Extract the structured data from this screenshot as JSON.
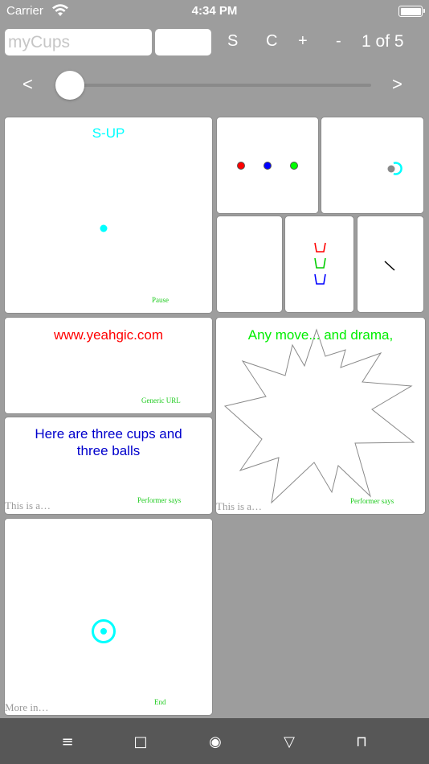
{
  "status": {
    "carrier": "Carrier",
    "time": "4:34 PM"
  },
  "toolbar": {
    "name_placeholder": "myCups",
    "s_label": "S",
    "c_label": "C",
    "plus_label": "+",
    "minus_label": "-",
    "page_count": "1 of 5"
  },
  "slider": {
    "prev_label": "<",
    "next_label": ">",
    "value_fraction": 0.0
  },
  "tiles": {
    "sup": {
      "title": "S-UP",
      "footer": "Pause",
      "title_color": "#00ffff",
      "ball_color": "#00ffff"
    },
    "balls": {
      "colors": [
        "#ff0000",
        "#0000ff",
        "#00ff00"
      ]
    },
    "cups": {
      "colors": [
        "#ff0000",
        "#00cc00",
        "#0000ff"
      ]
    },
    "url": {
      "title": "www.yeahgic.com",
      "footer": "Generic URL",
      "title_color": "#ff0000"
    },
    "drama": {
      "title": "Any move... and drama,",
      "footer": "Performer says",
      "more": "This is a…",
      "title_color": "#00ee00"
    },
    "cups_text": {
      "title": "Here are three cups and three balls",
      "footer": "Performer says",
      "more": "This is a…",
      "title_color": "#0000cc"
    },
    "end": {
      "footer": "End",
      "more": "More in…",
      "ring_color": "#00ffff"
    }
  },
  "bottom_bar": {
    "icons": [
      "menu-icon",
      "square-icon",
      "record-icon",
      "triangle-down-icon",
      "bracket-icon"
    ],
    "glyphs": [
      "≡",
      "□",
      "◉",
      "▽",
      "⊓"
    ]
  }
}
